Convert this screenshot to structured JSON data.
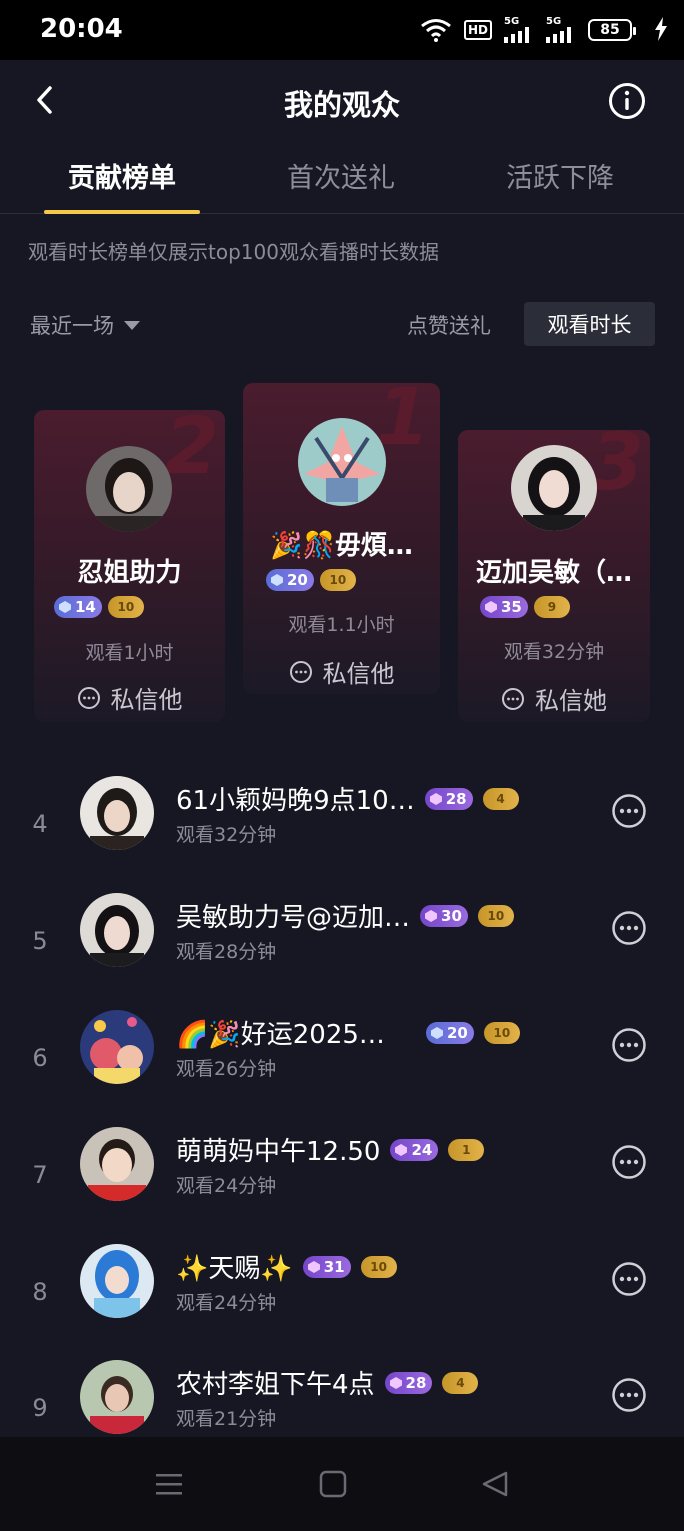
{
  "status_bar": {
    "time": "20:04",
    "battery": "85",
    "network_1": "5G",
    "network_2": "5G",
    "hd": "HD"
  },
  "header": {
    "title": "我的观众"
  },
  "tabs": [
    {
      "label": "贡献榜单"
    },
    {
      "label": "首次送礼"
    },
    {
      "label": "活跃下降"
    }
  ],
  "notice": "观看时长榜单仅展示top100观众看播时长数据",
  "filter": {
    "label": "最近一场"
  },
  "sort": {
    "likes_gifts": "点赞送礼",
    "watch_time": "观看时长"
  },
  "podium": [
    {
      "rank": "2",
      "name": "忍姐助力",
      "level": "14",
      "fan": "10",
      "watch": "观看1小时",
      "dm": "私信他"
    },
    {
      "rank": "1",
      "name": "🎉🎊毋煩…",
      "level": "20",
      "fan": "10",
      "watch": "观看1.1小时",
      "dm": "私信他"
    },
    {
      "rank": "3",
      "name": "迈加吴敏（…",
      "level": "35",
      "fan": "9",
      "watch": "观看32分钟",
      "dm": "私信她"
    }
  ],
  "list": [
    {
      "rank": "4",
      "name": "61小颖妈晚9点10…",
      "level": "28",
      "fan": "4",
      "watch": "观看32分钟"
    },
    {
      "rank": "5",
      "name": "吴敏助力号@迈加…",
      "level": "30",
      "fan": "10",
      "watch": "观看28分钟"
    },
    {
      "rank": "6",
      "name": "🌈🎉好运2025✨…",
      "level": "20",
      "fan": "10",
      "watch": "观看26分钟"
    },
    {
      "rank": "7",
      "name": "萌萌妈中午12.50",
      "level": "24",
      "fan": "1",
      "watch": "观看24分钟"
    },
    {
      "rank": "8",
      "name": "✨天赐✨",
      "level": "31",
      "fan": "10",
      "watch": "观看24分钟"
    },
    {
      "rank": "9",
      "name": "农村李姐下午4点",
      "level": "28",
      "fan": "4",
      "watch": "观看21分钟"
    }
  ],
  "colors": {
    "background": "#171724",
    "accent": "#f5c74a",
    "level_badge": "#6b73de",
    "fan_badge": "#d4a33a"
  }
}
